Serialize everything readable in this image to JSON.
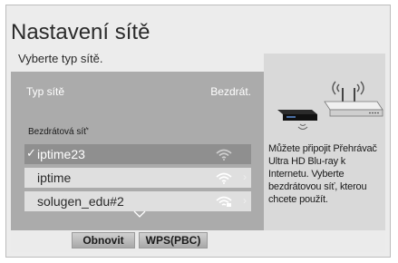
{
  "title": "Nastavení sítě",
  "subtitle": "Vyberte typ sítě.",
  "network_type": {
    "label": "Typ sítě",
    "value": "Bezdrát."
  },
  "list": {
    "section_label": "Bezdrátová síť'",
    "items": [
      {
        "name": "iptime23",
        "connected": true,
        "signal": "wifi-strong-icon"
      },
      {
        "name": "iptime",
        "connected": false,
        "signal": "wifi-icon"
      },
      {
        "name": "solugen_edu#2",
        "connected": false,
        "signal": "wifi-secure-icon"
      }
    ],
    "more_icon": "chevron-down-icon"
  },
  "buttons": {
    "refresh": "Obnovit",
    "wps": "WPS(PBC)"
  },
  "info_text": "Můžete připojit Přehrávač Ultra HD Blu-ray k Internetu. Vyberte bezdrátovou síť, kterou chcete použít.",
  "colors": {
    "panel": "#ababab",
    "highlight": "#8f8f8f",
    "selected": "#ffffff",
    "info_bg": "#d9d9d9"
  },
  "icons": {
    "connected_check": "✓",
    "arrow": "›",
    "illustration": "router-and-bluray-icon"
  }
}
